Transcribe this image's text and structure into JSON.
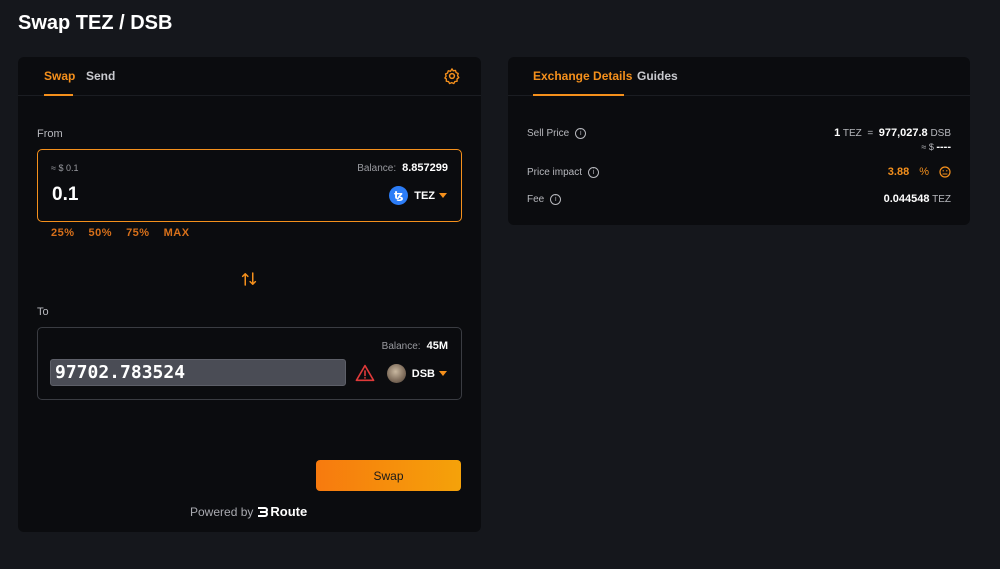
{
  "page": {
    "title": "Swap TEZ / DSB"
  },
  "left_panel": {
    "tabs": [
      {
        "label": "Swap"
      },
      {
        "label": "Send"
      }
    ],
    "from": {
      "section_label": "From",
      "usd_value": "≈ $ 0.1",
      "balance_label": "Balance:",
      "balance_value": "8.857299",
      "amount": "0.1",
      "token": "TEZ",
      "percent_buttons": [
        "25%",
        "50%",
        "75%",
        "MAX"
      ]
    },
    "to": {
      "section_label": "To",
      "balance_label": "Balance:",
      "balance_value": "45M",
      "amount": "97702.783524",
      "token": "DSB"
    },
    "swap_button": "Swap",
    "powered_by": "Powered by",
    "route_name": "Route"
  },
  "right_panel": {
    "tabs": [
      {
        "label": "Exchange Details"
      },
      {
        "label": "Guides"
      }
    ],
    "sell_price": {
      "label": "Sell Price",
      "lhs_amount": "1",
      "lhs_token": "TEZ",
      "equals": "=",
      "rhs_amount": "977,027.8",
      "rhs_token": "DSB",
      "usd_line": "≈ $",
      "usd_value": "----"
    },
    "price_impact": {
      "label": "Price impact",
      "value": "3.88",
      "unit": "%"
    },
    "fee": {
      "label": "Fee",
      "value": "0.044548",
      "token": "TEZ"
    }
  },
  "colors": {
    "accent": "#f5901c",
    "background": "#15171c",
    "card": "#0b0c0f",
    "warning": "#e03a3a"
  }
}
